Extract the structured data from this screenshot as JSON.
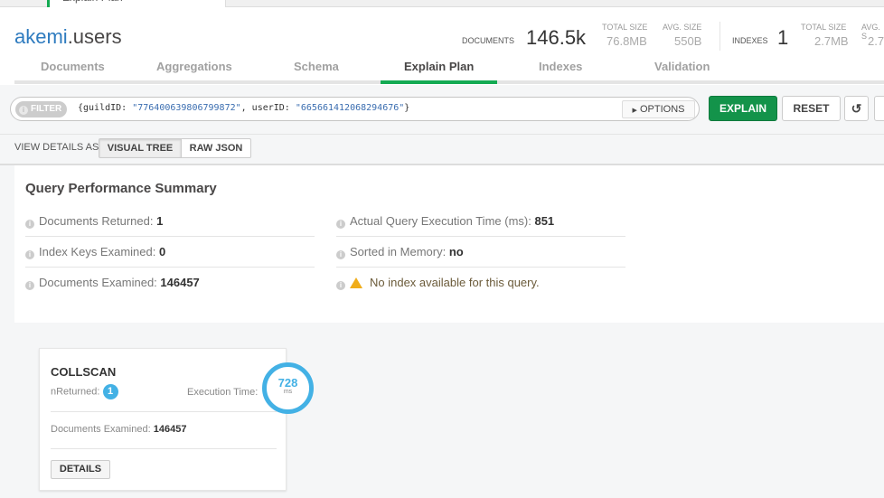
{
  "window_tab": {
    "label": "Explain Plan"
  },
  "header": {
    "db": "akemi",
    "collection": ".users",
    "documents": {
      "label": "DOCUMENTS",
      "value": "146.5k",
      "total_size_label": "TOTAL SIZE",
      "total_size": "76.8MB",
      "avg_size_label": "AVG. SIZE",
      "avg_size": "550B"
    },
    "indexes": {
      "label": "INDEXES",
      "value": "1",
      "total_size_label": "TOTAL SIZE",
      "total_size": "2.7MB",
      "avg_size_label": "AVG. S",
      "avg_size": "2.7"
    }
  },
  "tabs": [
    {
      "label": "Documents"
    },
    {
      "label": "Aggregations"
    },
    {
      "label": "Schema"
    },
    {
      "label": "Explain Plan",
      "active": true
    },
    {
      "label": "Indexes"
    },
    {
      "label": "Validation"
    }
  ],
  "filter": {
    "pill": "FILTER",
    "q1": "{guildID: ",
    "v1": "\"776400639806799872\"",
    "q2": ", userID: ",
    "v2": "\"665661412068294676\"",
    "q3": "}",
    "options": "OPTIONS"
  },
  "buttons": {
    "explain": "EXPLAIN",
    "reset": "RESET"
  },
  "view": {
    "label": "VIEW DETAILS AS",
    "visual": "VISUAL TREE",
    "raw": "RAW JSON"
  },
  "summary": {
    "title": "Query Performance Summary",
    "docs_returned": {
      "label": "Documents Returned:",
      "value": "1"
    },
    "keys_examined": {
      "label": "Index Keys Examined:",
      "value": "0"
    },
    "docs_examined": {
      "label": "Documents Examined:",
      "value": "146457"
    },
    "exec_time": {
      "label": "Actual Query Execution Time (ms):",
      "value": "851"
    },
    "sorted": {
      "label": "Sorted in Memory:",
      "value": "no"
    },
    "warning": "No index available for this query."
  },
  "stage": {
    "name": "COLLSCAN",
    "nreturned_label": "nReturned:",
    "nreturned": "1",
    "exec_label": "Execution Time:",
    "exec_value": "728",
    "exec_unit": "ms",
    "docs_label": "Documents Examined:",
    "docs_value": "146457",
    "details": "DETAILS"
  },
  "colors": {
    "accent": "#13aa52",
    "explain": "#13934a",
    "badge": "#43b1e5"
  }
}
